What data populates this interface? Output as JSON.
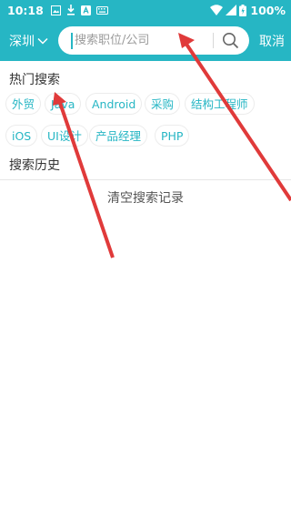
{
  "status_bar": {
    "time": "10:18",
    "battery": "100%"
  },
  "header": {
    "city": "深圳",
    "search_placeholder": "搜索职位/公司",
    "cancel_label": "取消"
  },
  "hot_search": {
    "title": "热门搜索",
    "tags": [
      "外贸",
      "Java",
      "Android",
      "采购",
      "结构工程师",
      "iOS",
      "UI设计",
      "产品经理",
      "PHP"
    ]
  },
  "history": {
    "title": "搜索历史",
    "clear_label": "清空搜索记录"
  },
  "colors": {
    "accent": "#26b6c4",
    "annotation_arrow": "#e03a3a"
  }
}
